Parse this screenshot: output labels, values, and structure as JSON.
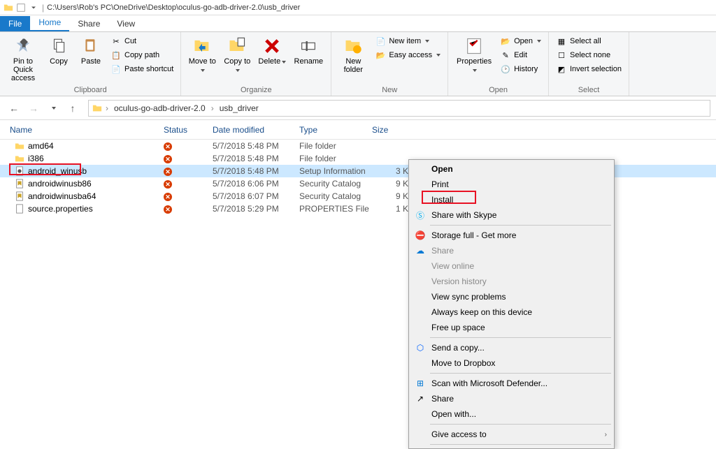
{
  "titlebar": {
    "path": "C:\\Users\\Rob's PC\\OneDrive\\Desktop\\oculus-go-adb-driver-2.0\\usb_driver"
  },
  "tabs": {
    "file": "File",
    "home": "Home",
    "share": "Share",
    "view": "View"
  },
  "ribbon": {
    "pin": "Pin to Quick access",
    "copy": "Copy",
    "paste": "Paste",
    "cut": "Cut",
    "copypath": "Copy path",
    "pasteshortcut": "Paste shortcut",
    "clipboard": "Clipboard",
    "moveto": "Move to",
    "copyto": "Copy to",
    "delete": "Delete",
    "rename": "Rename",
    "organize": "Organize",
    "newfolder": "New folder",
    "newitem": "New item",
    "easyaccess": "Easy access",
    "new": "New",
    "properties": "Properties",
    "open": "Open",
    "edit": "Edit",
    "history": "History",
    "open_group": "Open",
    "selectall": "Select all",
    "selectnone": "Select none",
    "invert": "Invert selection",
    "select": "Select"
  },
  "breadcrumb": {
    "a": "oculus-go-adb-driver-2.0",
    "b": "usb_driver"
  },
  "columns": {
    "name": "Name",
    "status": "Status",
    "date": "Date modified",
    "type": "Type",
    "size": "Size"
  },
  "rows": [
    {
      "name": "amd64",
      "date": "5/7/2018 5:48 PM",
      "type": "File folder",
      "size": "",
      "icon": "folder"
    },
    {
      "name": "i386",
      "date": "5/7/2018 5:48 PM",
      "type": "File folder",
      "size": "",
      "icon": "folder"
    },
    {
      "name": "android_winusb",
      "date": "5/7/2018 5:48 PM",
      "type": "Setup Information",
      "size": "3 KB",
      "icon": "inf",
      "selected": true
    },
    {
      "name": "androidwinusb86",
      "date": "5/7/2018 6:06 PM",
      "type": "Security Catalog",
      "size": "9 KB",
      "icon": "cat"
    },
    {
      "name": "androidwinusba64",
      "date": "5/7/2018 6:07 PM",
      "type": "Security Catalog",
      "size": "9 KB",
      "icon": "cat"
    },
    {
      "name": "source.properties",
      "date": "5/7/2018 5:29 PM",
      "type": "PROPERTIES File",
      "size": "1 KB",
      "icon": "file"
    }
  ],
  "ctx": {
    "open": "Open",
    "print": "Print",
    "install": "Install",
    "skype": "Share with Skype",
    "storage": "Storage full - Get more",
    "share": "Share",
    "viewonline": "View online",
    "version": "Version history",
    "sync": "View sync problems",
    "keep": "Always keep on this device",
    "free": "Free up space",
    "sendcopy": "Send a copy...",
    "dropbox": "Move to Dropbox",
    "defender": "Scan with Microsoft Defender...",
    "share2": "Share",
    "openwith": "Open with...",
    "giveaccess": "Give access to"
  }
}
